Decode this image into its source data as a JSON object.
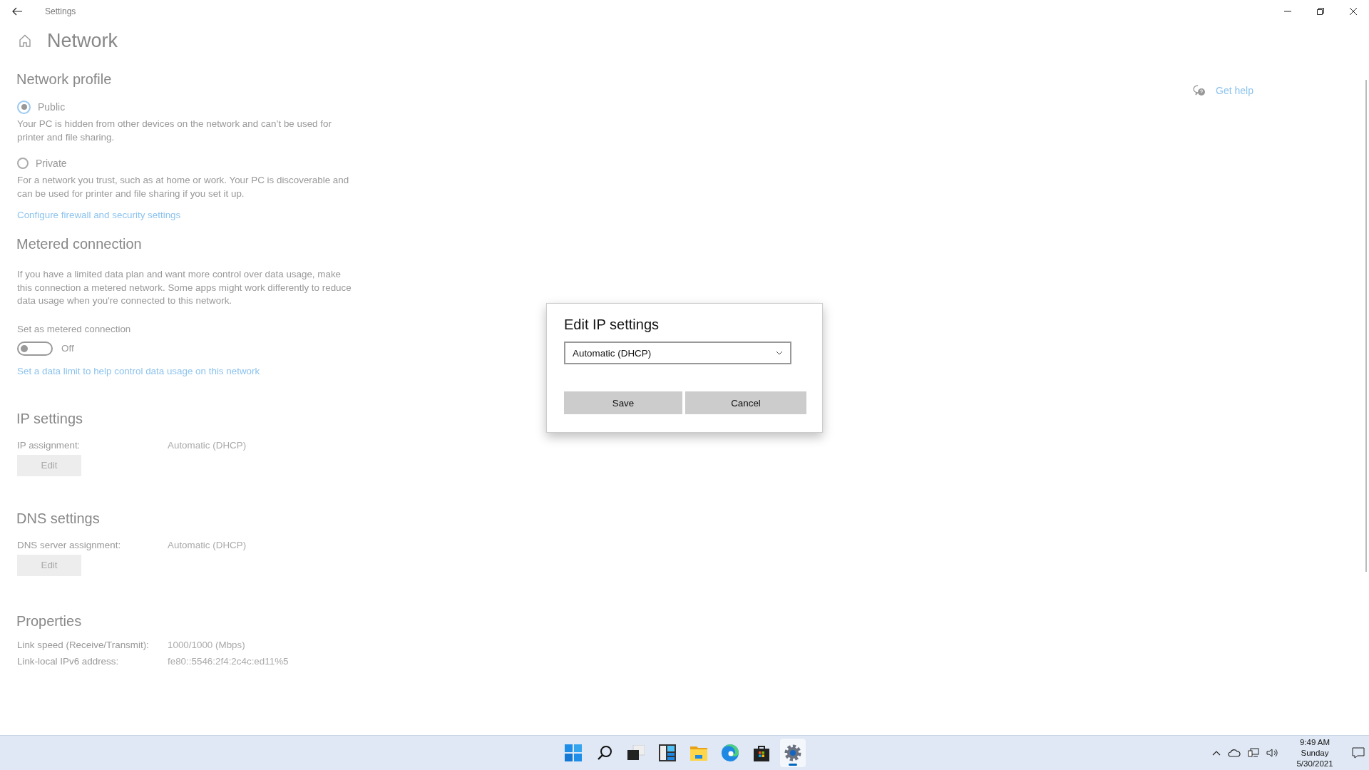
{
  "window": {
    "title": "Settings"
  },
  "page": {
    "title": "Network",
    "help_link": "Get help"
  },
  "network_profile": {
    "heading": "Network profile",
    "options": [
      {
        "label": "Public",
        "description": "Your PC is hidden from other devices on the network and can’t be used for printer and file sharing.",
        "selected": true
      },
      {
        "label": "Private",
        "description": "For a network you trust, such as at home or work. Your PC is discoverable and can be used for printer and file sharing if you set it up.",
        "selected": false
      }
    ],
    "link": "Configure firewall and security settings"
  },
  "metered_connection": {
    "heading": "Metered connection",
    "description": "If you have a limited data plan and want more control over data usage, make this connection a metered network. Some apps might work differently to reduce data usage when you're connected to this network.",
    "toggle_label": "Set as metered connection",
    "toggle": {
      "on": false,
      "state_text": "Off"
    },
    "link": "Set a data limit to help control data usage on this network"
  },
  "ip_settings": {
    "heading": "IP settings",
    "rows": [
      {
        "label": "IP assignment:",
        "value": "Automatic (DHCP)"
      }
    ],
    "button": "Edit"
  },
  "dns_settings": {
    "heading": "DNS settings",
    "rows": [
      {
        "label": "DNS server assignment:",
        "value": "Automatic (DHCP)"
      }
    ],
    "button": "Edit"
  },
  "properties": {
    "heading": "Properties",
    "rows": [
      {
        "label": "Link speed (Receive/Transmit):",
        "value": "1000/1000 (Mbps)"
      },
      {
        "label": "Link-local IPv6 address:",
        "value": "fe80::5546:2f4:2c4c:ed11%5"
      }
    ]
  },
  "dialog": {
    "title": "Edit IP settings",
    "dropdown": {
      "value": "Automatic (DHCP)"
    },
    "buttons": [
      "Save",
      "Cancel"
    ]
  },
  "taskbar": {
    "apps": [
      {
        "kind": "start",
        "selected": false
      },
      {
        "kind": "search",
        "selected": false
      },
      {
        "kind": "taskview",
        "selected": false
      },
      {
        "kind": "widgets",
        "selected": false
      },
      {
        "kind": "explorer",
        "selected": false
      },
      {
        "kind": "browser",
        "selected": false
      },
      {
        "kind": "store",
        "selected": false
      },
      {
        "kind": "settings",
        "selected": true
      }
    ],
    "tray": {
      "time": "9:49 AM",
      "day": "Sunday",
      "date": "5/30/2021"
    }
  }
}
